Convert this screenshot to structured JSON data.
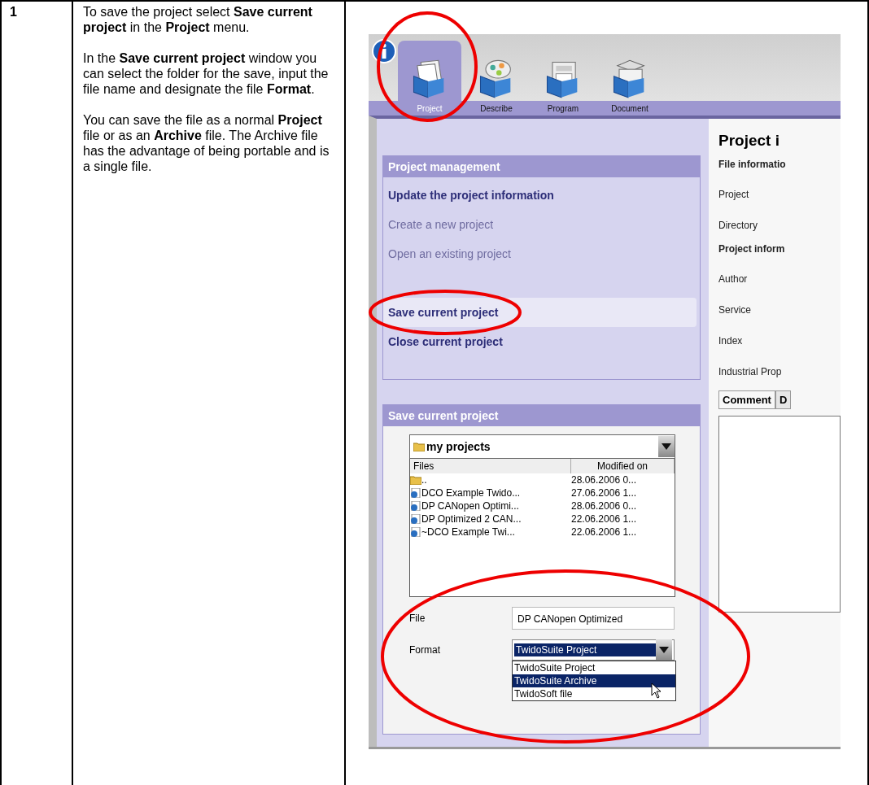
{
  "step": {
    "number": "1",
    "paragraphs": [
      "To save the project select **Save current project** in the **Project** menu.",
      "In the **Save current project** window you can select the folder for the save, input the file name and designate the file **Format**.",
      "You can save the file as a normal **Project** file or as an **Archive** file. The Archive file has the advantage of being portable and is a single file."
    ]
  },
  "screenshot": {
    "tabs": [
      {
        "label": "Project",
        "selected": true
      },
      {
        "label": "Describe",
        "selected": false
      },
      {
        "label": "Program",
        "selected": false
      },
      {
        "label": "Document",
        "selected": false
      }
    ],
    "menu": {
      "title": "Project management",
      "items": [
        {
          "label": "Update the project information",
          "disabled": false,
          "selected": false
        },
        {
          "label": "Create a new project",
          "disabled": true,
          "selected": false
        },
        {
          "label": "Open an existing project",
          "disabled": true,
          "selected": false
        },
        {
          "label": "Save current project",
          "disabled": false,
          "selected": true
        },
        {
          "label": "Close current project",
          "disabled": false,
          "selected": false
        }
      ]
    },
    "save": {
      "title": "Save current project",
      "folder": "my projects",
      "columns": [
        "Files",
        "Modified on"
      ],
      "rows": [
        {
          "kind": "folder",
          "name": "..",
          "modified": "28.06.2006 0..."
        },
        {
          "kind": "project",
          "name": "DCO Example Twido...",
          "modified": "27.06.2006 1..."
        },
        {
          "kind": "project",
          "name": "DP CANopen Optimi...",
          "modified": "28.06.2006 0..."
        },
        {
          "kind": "project",
          "name": "DP Optimized 2 CAN...",
          "modified": "22.06.2006 1..."
        },
        {
          "kind": "project",
          "name": "~DCO Example Twi...",
          "modified": "22.06.2006 1..."
        }
      ],
      "file_label": "File",
      "file_value": "DP CANopen Optimized",
      "format_label": "Format",
      "format_value": "TwidoSuite Project",
      "format_options": [
        {
          "label": "TwidoSuite Project",
          "selected": false
        },
        {
          "label": "TwidoSuite Archive",
          "selected": true
        },
        {
          "label": "TwidoSoft file",
          "selected": false
        }
      ]
    },
    "info": {
      "title": "Project i",
      "fields": [
        {
          "kind": "heading",
          "label": "File informatio"
        },
        {
          "kind": "field",
          "label": "Project"
        },
        {
          "kind": "field",
          "label": "Directory"
        },
        {
          "kind": "heading",
          "label": "Project inform"
        },
        {
          "kind": "field",
          "label": "Author"
        },
        {
          "kind": "field",
          "label": "Service"
        },
        {
          "kind": "field",
          "label": "Index"
        },
        {
          "kind": "field",
          "label": "Industrial Prop"
        }
      ],
      "tabs": [
        {
          "label": "Comment",
          "selected": true
        },
        {
          "label": "D",
          "selected": false
        }
      ]
    }
  }
}
